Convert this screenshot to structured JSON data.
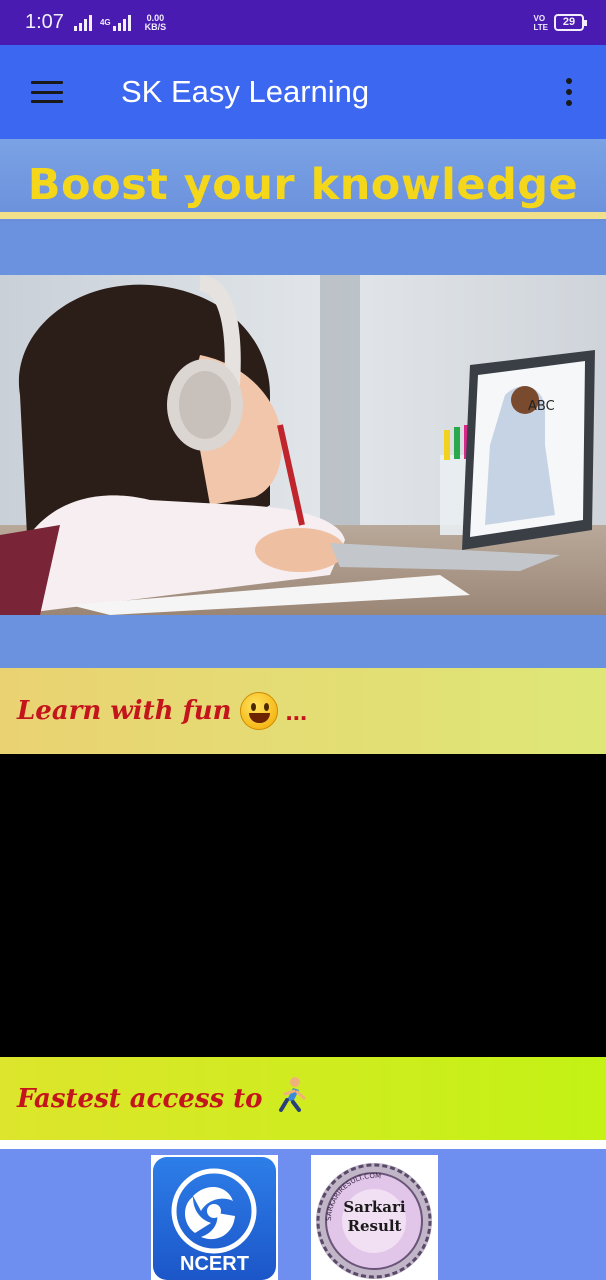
{
  "status_bar": {
    "time": "1:07",
    "network_tag": "4G",
    "speed_value": "0.00",
    "speed_unit": "KB/S",
    "volte_line1": "VO",
    "volte_line2": "LTE",
    "battery": "29"
  },
  "app_bar": {
    "title": "SK Easy Learning",
    "menu_icon": "hamburger-menu-icon",
    "overflow_icon": "more-vert-icon"
  },
  "hero": {
    "headline": "Boost your knowledge"
  },
  "banners": {
    "fun_text": "Learn with fun",
    "fun_suffix": "...",
    "fast_text": "Fastest access to"
  },
  "links": [
    {
      "label": "NCERT",
      "icon": "ncert-logo"
    },
    {
      "label_line1": "Sarkari",
      "label_line2": "Result",
      "ring_text": "SARKARIRESULT.COM",
      "icon": "sarkari-result-logo"
    }
  ],
  "colors": {
    "status_bar": "#4a1bb0",
    "app_bar": "#3c67f0",
    "headline": "#f4d71a",
    "banner_text": "#c4141c",
    "background": "#6b92df"
  }
}
